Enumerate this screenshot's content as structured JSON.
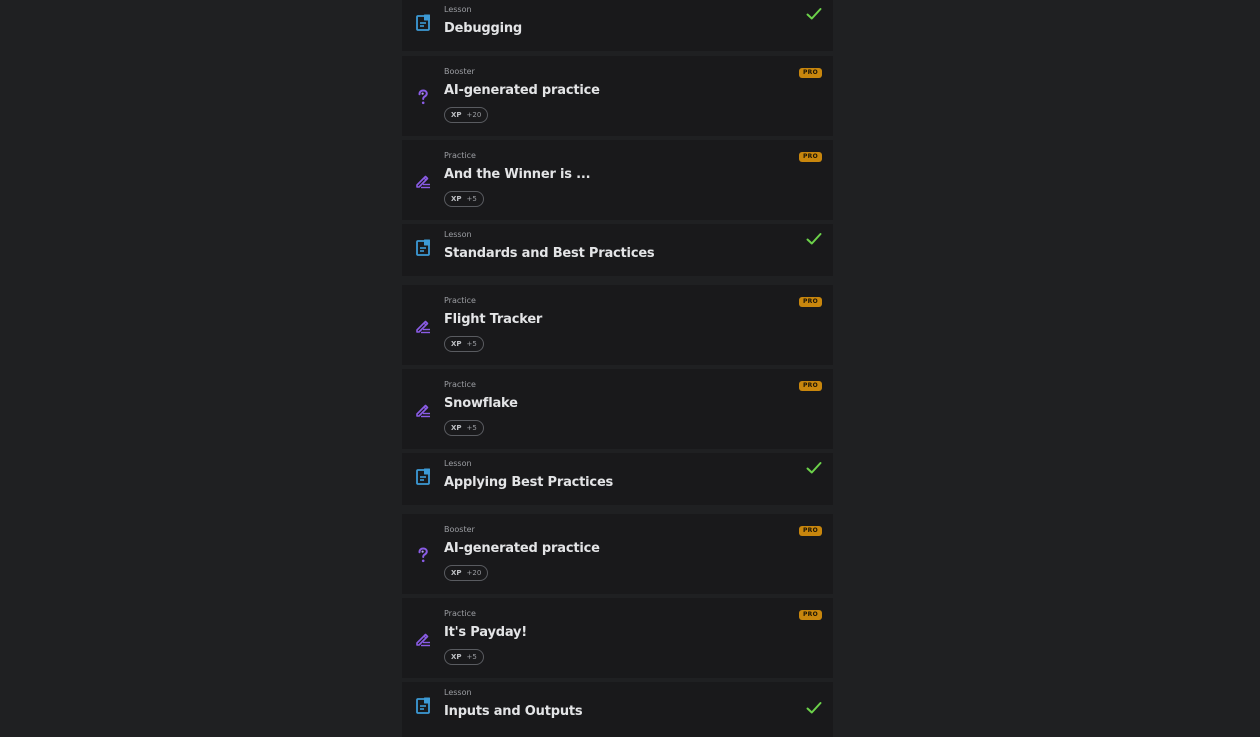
{
  "colors": {
    "page_background": "#1f2022",
    "card_background": "#19191b",
    "lesson_icon": "#3c9ad6",
    "practice_icon": "#8a5ce6",
    "check": "#6cd24a",
    "pro_badge": "#c8860d"
  },
  "items": [
    {
      "type": "lesson",
      "kind": "Lesson",
      "title": "Debugging",
      "status_icon": "check-icon",
      "icon": "document-icon"
    },
    {
      "type": "booster",
      "kind": "Booster",
      "title": "AI-generated practice",
      "badge": "PRO",
      "xp_label": "XP",
      "xp_value": "+20",
      "icon": "question-icon"
    },
    {
      "type": "practice",
      "kind": "Practice",
      "title": "And the Winner is ...",
      "badge": "PRO",
      "xp_label": "XP",
      "xp_value": "+5",
      "icon": "pencil-lines-icon"
    },
    {
      "type": "lesson",
      "kind": "Lesson",
      "title": "Standards and Best Practices",
      "status_icon": "check-icon",
      "icon": "document-icon"
    },
    {
      "type": "practice",
      "kind": "Practice",
      "title": "Flight Tracker",
      "badge": "PRO",
      "xp_label": "XP",
      "xp_value": "+5",
      "icon": "pencil-lines-icon"
    },
    {
      "type": "practice",
      "kind": "Practice",
      "title": "Snowflake",
      "badge": "PRO",
      "xp_label": "XP",
      "xp_value": "+5",
      "icon": "pencil-lines-icon"
    },
    {
      "type": "lesson",
      "kind": "Lesson",
      "title": "Applying Best Practices",
      "status_icon": "check-icon",
      "icon": "document-icon"
    },
    {
      "type": "booster",
      "kind": "Booster",
      "title": "AI-generated practice",
      "badge": "PRO",
      "xp_label": "XP",
      "xp_value": "+20",
      "icon": "question-icon"
    },
    {
      "type": "practice",
      "kind": "Practice",
      "title": "It's Payday!",
      "badge": "PRO",
      "xp_label": "XP",
      "xp_value": "+5",
      "icon": "pencil-lines-icon"
    },
    {
      "type": "lesson",
      "kind": "Lesson",
      "title": "Inputs and Outputs",
      "status_icon": "check-icon",
      "icon": "document-icon"
    }
  ]
}
